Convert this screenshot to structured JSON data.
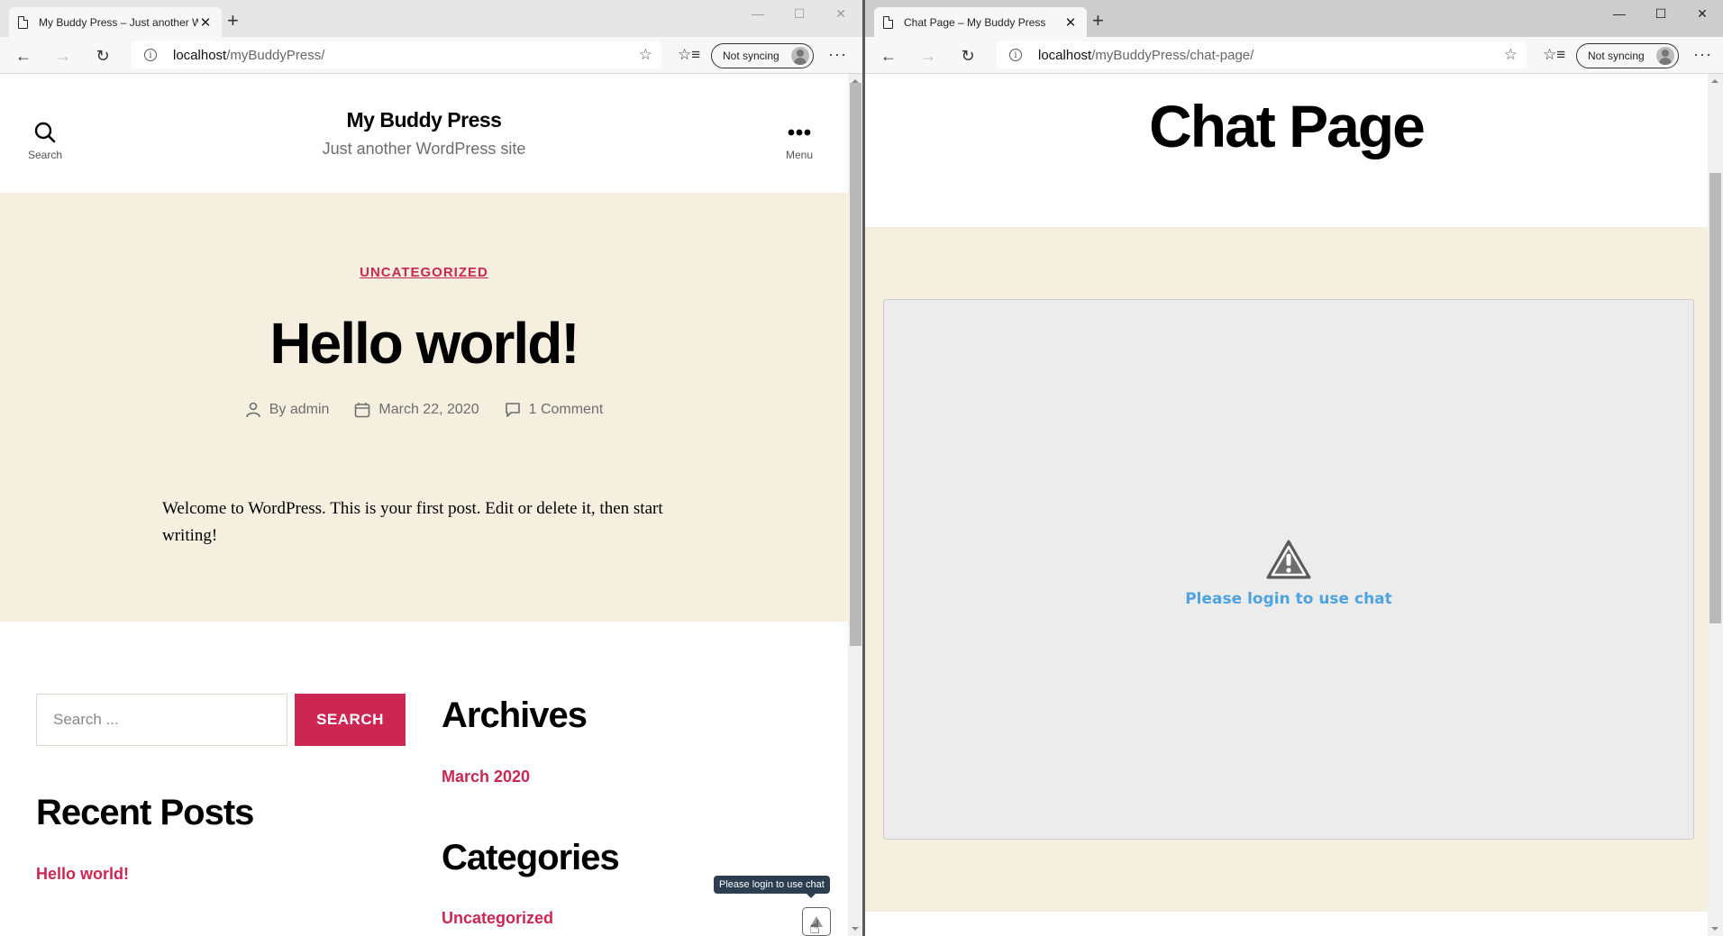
{
  "left_browser": {
    "tab_title": "My Buddy Press – Just another W",
    "url_host": "localhost",
    "url_path": "/myBuddyPress/",
    "sync_label": "Not syncing",
    "window_controls": [
      "—",
      "☐",
      "✕"
    ]
  },
  "right_browser": {
    "tab_title": "Chat Page – My Buddy Press",
    "url_host": "localhost",
    "url_path": "/myBuddyPress/chat-page/",
    "sync_label": "Not syncing",
    "window_controls": [
      "—",
      "☐",
      "✕"
    ]
  },
  "left_page": {
    "header": {
      "search_label": "Search",
      "site_title": "My Buddy Press",
      "tagline": "Just another WordPress site",
      "menu_label": "Menu"
    },
    "post": {
      "category": "UNCATEGORIZED",
      "title": "Hello world!",
      "author_prefix": "By",
      "author": "admin",
      "date": "March 22, 2020",
      "comments": "1 Comment",
      "body": "Welcome to WordPress. This is your first post. Edit or delete it, then start writing!"
    },
    "widgets": {
      "search_placeholder": "Search ...",
      "search_button": "SEARCH",
      "recent_posts_title": "Recent Posts",
      "recent_posts": [
        "Hello world!"
      ],
      "archives_title": "Archives",
      "archives": [
        "March 2020"
      ],
      "categories_title": "Categories",
      "categories": [
        "Uncategorized"
      ]
    },
    "chat_tooltip": "Please login to use chat"
  },
  "right_page": {
    "title": "Chat Page",
    "chat_message": "Please login to use chat"
  },
  "colors": {
    "accent": "#cd2653",
    "beige": "#f5efe0",
    "chat_link": "#4ea3e0",
    "tooltip_bg": "#2c3e50"
  }
}
